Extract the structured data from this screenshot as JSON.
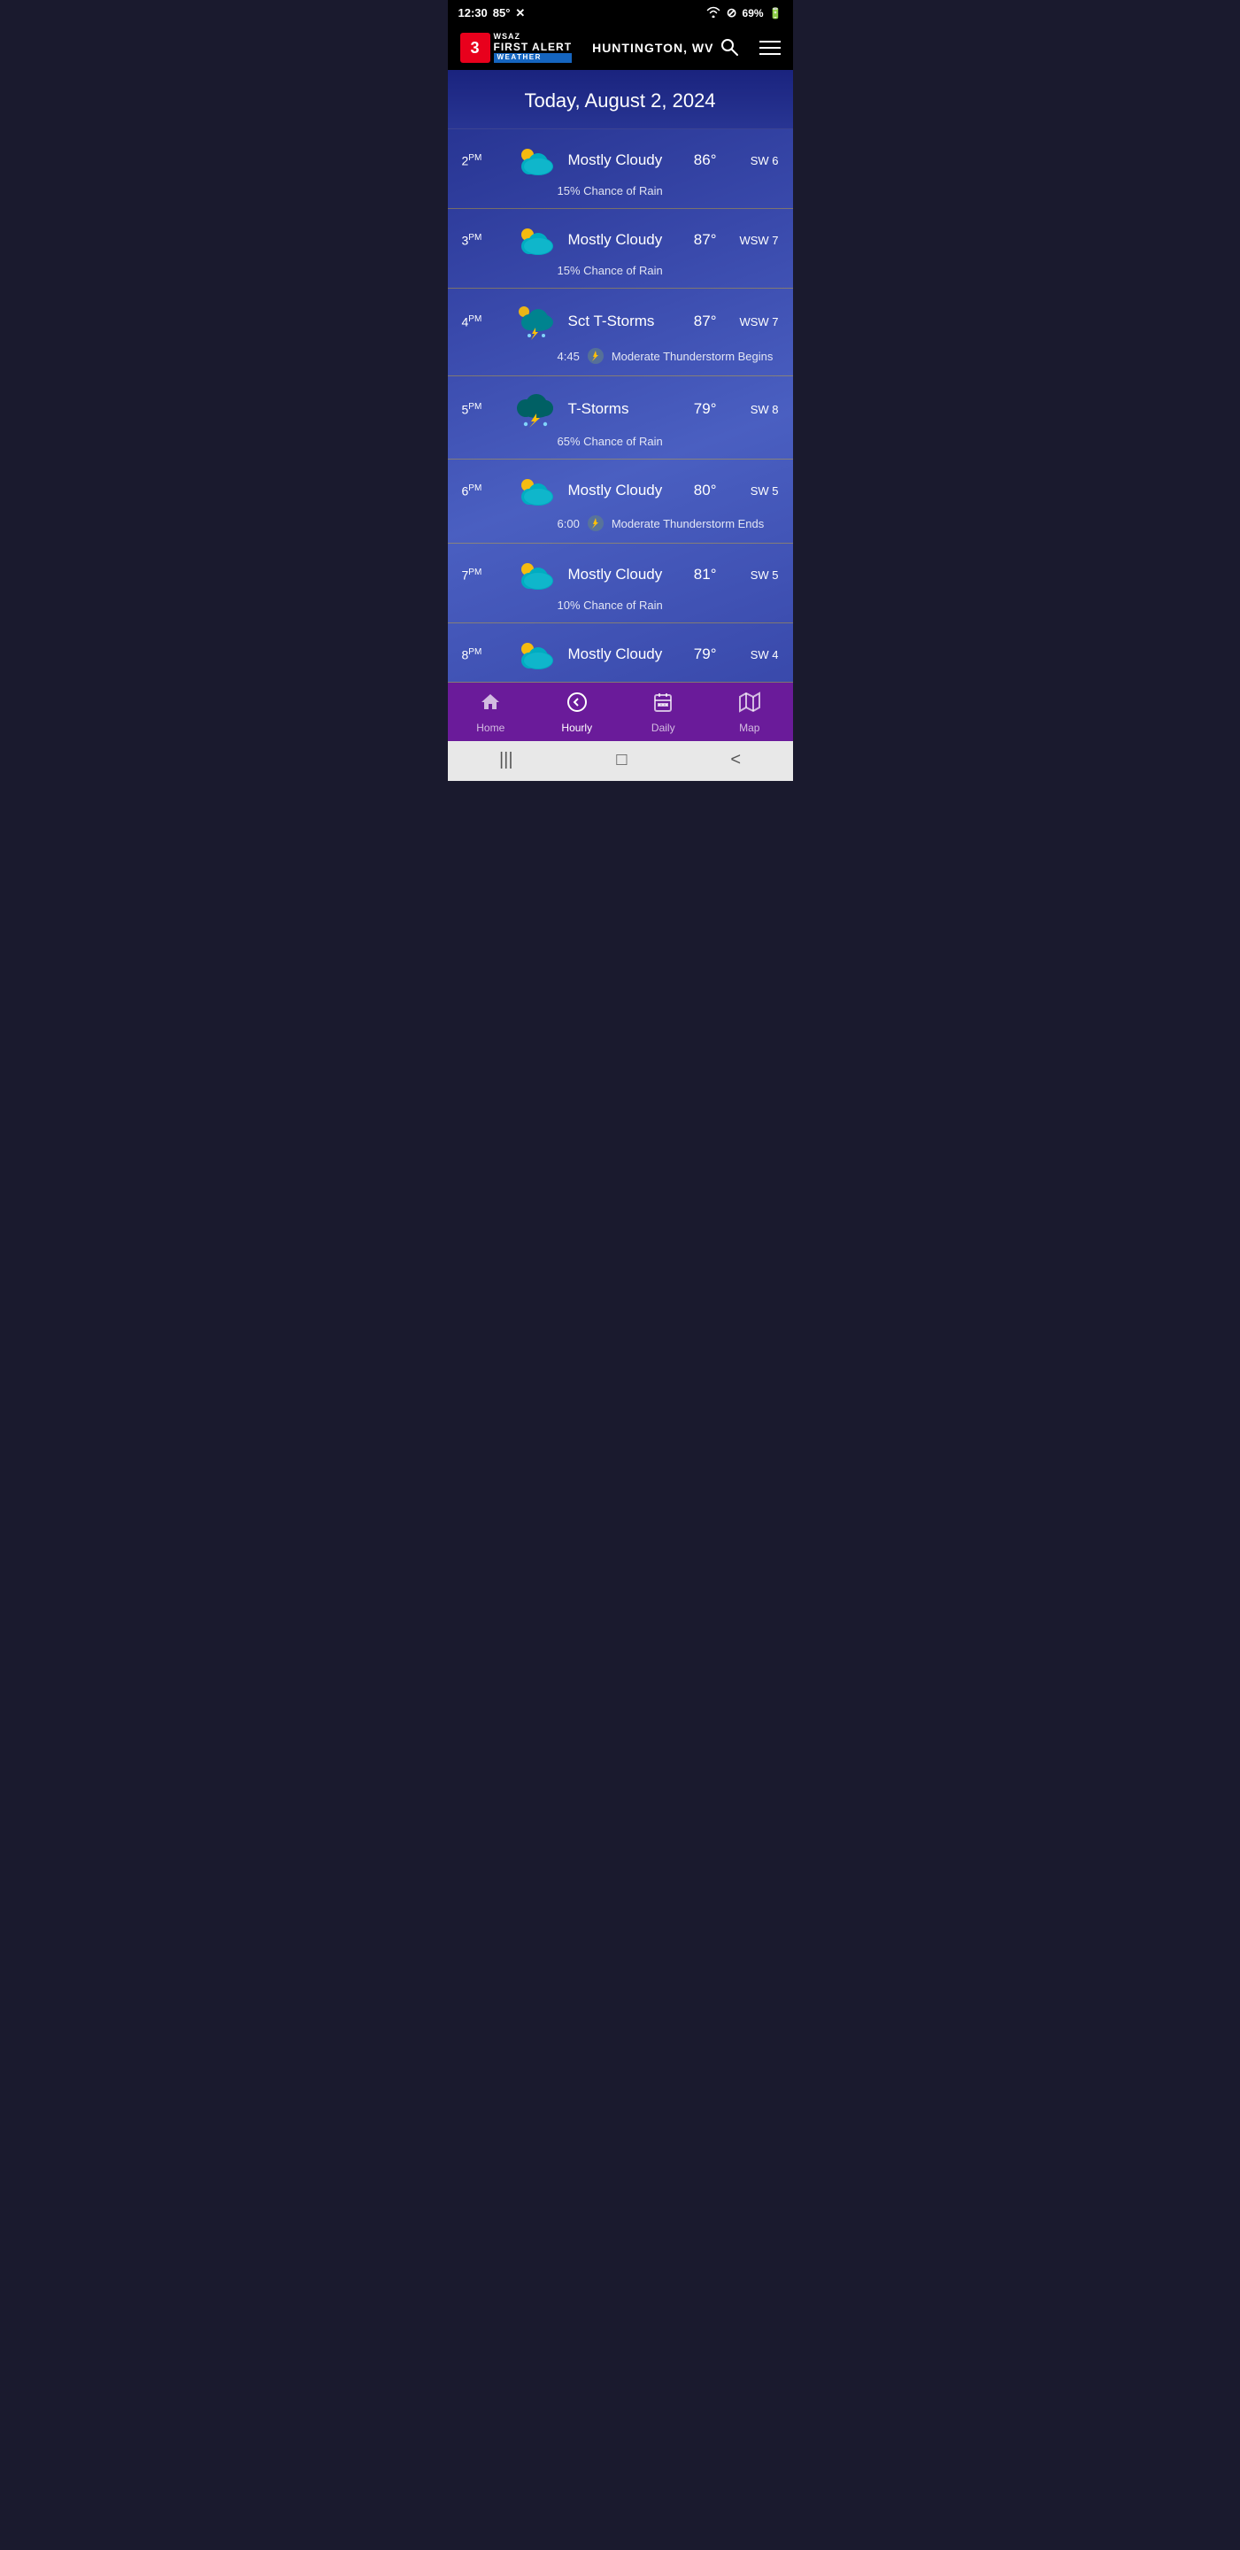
{
  "statusBar": {
    "time": "12:30",
    "temp": "85°",
    "batteryPct": "69%",
    "wifiIcon": "wifi",
    "blockIcon": "⊘",
    "batteryIcon": "battery"
  },
  "header": {
    "logoNumber": "3",
    "logoFirst": "WSAZ",
    "logoAlert": "FIRST ALERT",
    "logoWeather": "WEATHER",
    "location": "HUNTINGTON, WV",
    "searchIcon": "search",
    "menuIcon": "menu"
  },
  "dateBanner": {
    "text": "Today, August 2, 2024"
  },
  "hourlyRows": [
    {
      "time": "2",
      "period": "PM",
      "icon": "mostly-cloudy-sun",
      "condition": "Mostly Cloudy",
      "temp": "86°",
      "wind": "SW 6",
      "detail": "15% Chance of Rain",
      "event": null
    },
    {
      "time": "3",
      "period": "PM",
      "icon": "mostly-cloudy-sun",
      "condition": "Mostly Cloudy",
      "temp": "87°",
      "wind": "WSW 7",
      "detail": "15% Chance of Rain",
      "event": null
    },
    {
      "time": "4",
      "period": "PM",
      "icon": "scatter-tstorm",
      "condition": "Sct T-Storms",
      "temp": "87°",
      "wind": "WSW 7",
      "detail": null,
      "event": {
        "time": "4:45",
        "text": "Moderate Thunderstorm Begins"
      }
    },
    {
      "time": "5",
      "period": "PM",
      "icon": "tstorm",
      "condition": "T-Storms",
      "temp": "79°",
      "wind": "SW 8",
      "detail": "65% Chance of Rain",
      "event": null
    },
    {
      "time": "6",
      "period": "PM",
      "icon": "mostly-cloudy-sun",
      "condition": "Mostly Cloudy",
      "temp": "80°",
      "wind": "SW 5",
      "detail": null,
      "event": {
        "time": "6:00",
        "text": "Moderate Thunderstorm Ends"
      }
    },
    {
      "time": "7",
      "period": "PM",
      "icon": "mostly-cloudy-sun",
      "condition": "Mostly Cloudy",
      "temp": "81°",
      "wind": "SW 5",
      "detail": "10% Chance of Rain",
      "event": null
    },
    {
      "time": "8",
      "period": "PM",
      "icon": "mostly-cloudy-sun",
      "condition": "Mostly Cloudy",
      "temp": "79°",
      "wind": "SW 4",
      "detail": null,
      "event": null
    }
  ],
  "bottomNav": {
    "items": [
      {
        "id": "home",
        "label": "Home",
        "icon": "home",
        "active": false
      },
      {
        "id": "hourly",
        "label": "Hourly",
        "icon": "back-circle",
        "active": true
      },
      {
        "id": "daily",
        "label": "Daily",
        "icon": "calendar",
        "active": false
      },
      {
        "id": "map",
        "label": "Map",
        "icon": "map",
        "active": false
      }
    ]
  },
  "systemNav": {
    "recentIcon": "|||",
    "homeIcon": "□",
    "backIcon": "<"
  }
}
